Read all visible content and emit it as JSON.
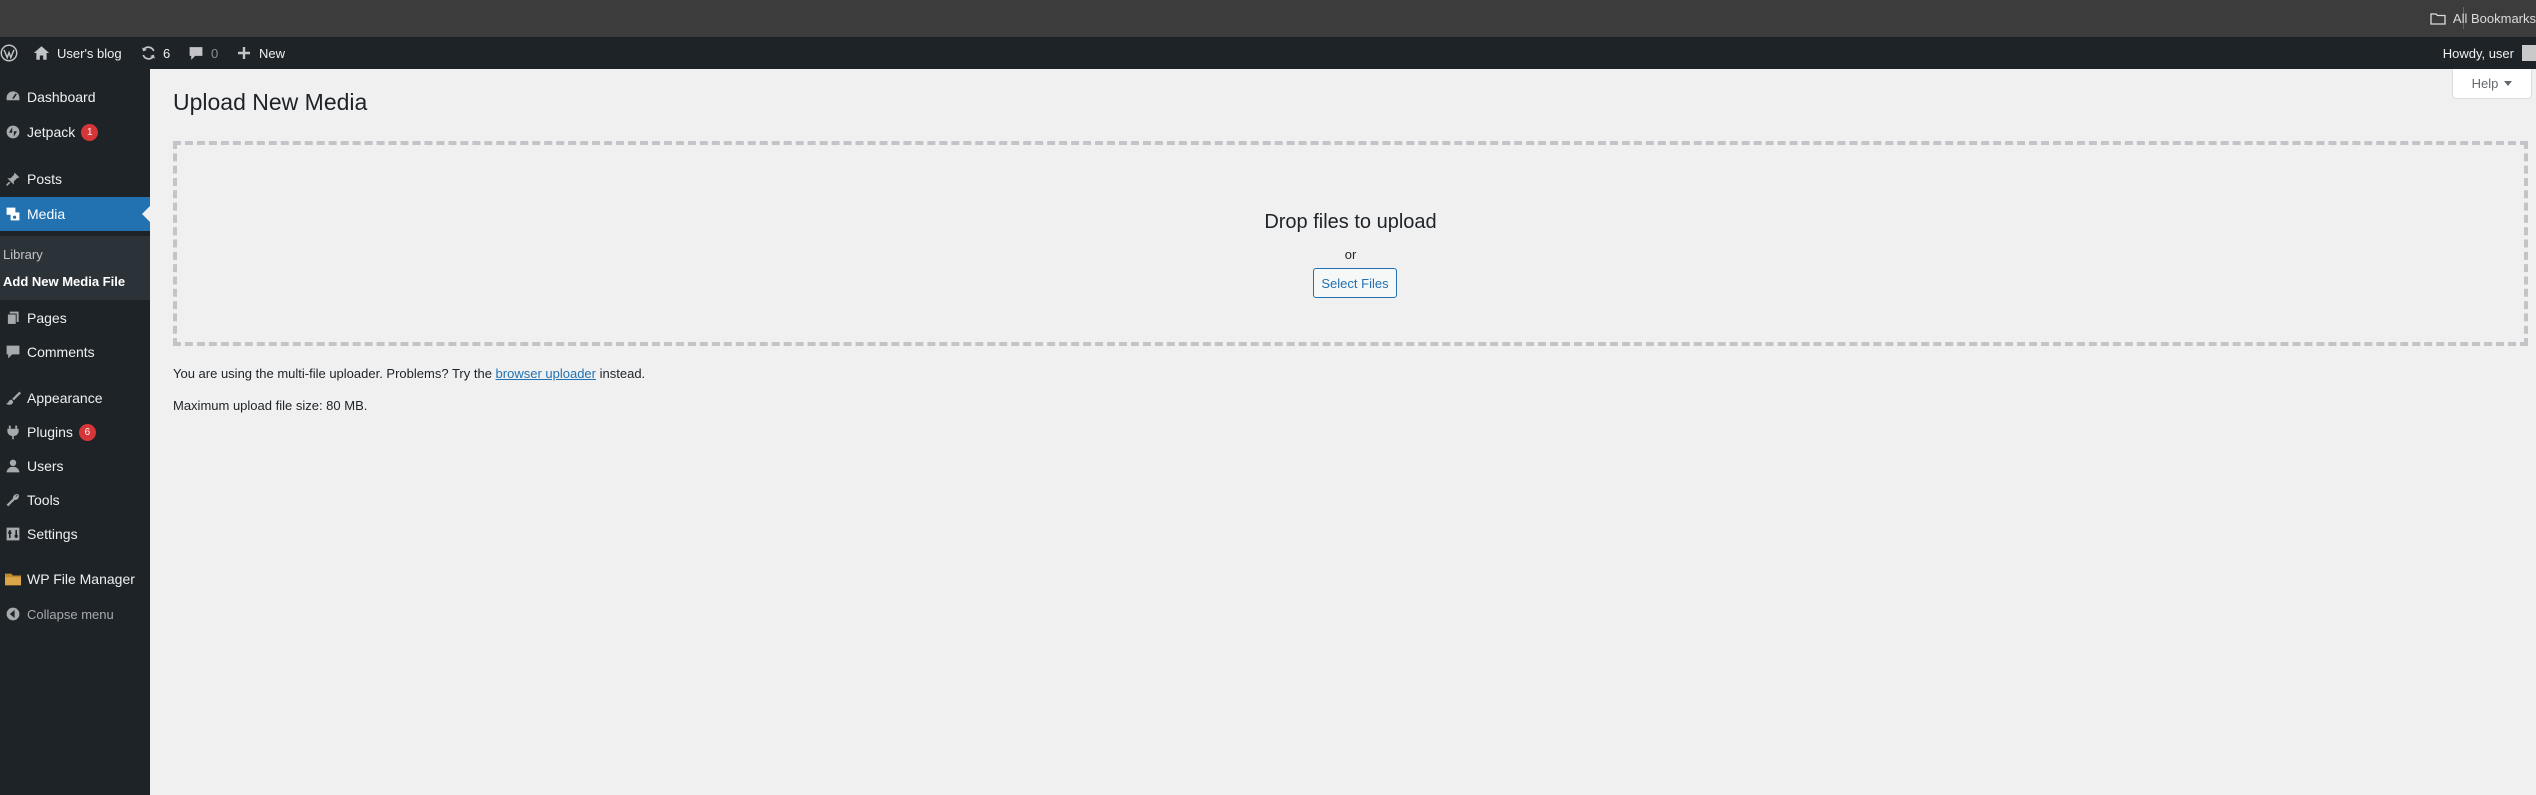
{
  "browser": {
    "bookmarks_label": "All Bookmarks"
  },
  "admin_bar": {
    "site_name": "User's blog",
    "updates_count": "6",
    "comments_count": "0",
    "new_label": "New",
    "greeting": "Howdy, user"
  },
  "sidebar": {
    "items": [
      {
        "label": "Dashboard",
        "icon": "dashboard-icon"
      },
      {
        "label": "Jetpack",
        "icon": "jetpack-icon",
        "badge": "1"
      },
      {
        "label": "Posts",
        "icon": "pin-icon"
      },
      {
        "label": "Media",
        "icon": "media-icon",
        "current": true
      },
      {
        "label": "Pages",
        "icon": "pages-icon"
      },
      {
        "label": "Comments",
        "icon": "comment-icon"
      },
      {
        "label": "Appearance",
        "icon": "brush-icon"
      },
      {
        "label": "Plugins",
        "icon": "plugin-icon",
        "badge": "6"
      },
      {
        "label": "Users",
        "icon": "user-icon"
      },
      {
        "label": "Tools",
        "icon": "wrench-icon"
      },
      {
        "label": "Settings",
        "icon": "settings-icon"
      },
      {
        "label": "WP File Manager",
        "icon": "folder-icon"
      }
    ],
    "media_submenu": [
      "Library",
      "Add New Media File"
    ],
    "collapse_label": "Collapse menu"
  },
  "main": {
    "title": "Upload New Media",
    "help_label": "Help",
    "drop_title": "Drop files to upload",
    "drop_or": "or",
    "select_files_label": "Select Files",
    "uploader_note_prefix": "You are using the multi-file uploader. Problems? Try the",
    "uploader_note_link": "browser uploader",
    "uploader_note_suffix": "instead.",
    "max_upload": "Maximum upload file size: 80 MB."
  },
  "colors": {
    "admin_bar": "#1d2327",
    "sidebar": "#1d2327",
    "accent": "#2271b1",
    "badge": "#d63638",
    "background": "#f0f0f1"
  }
}
